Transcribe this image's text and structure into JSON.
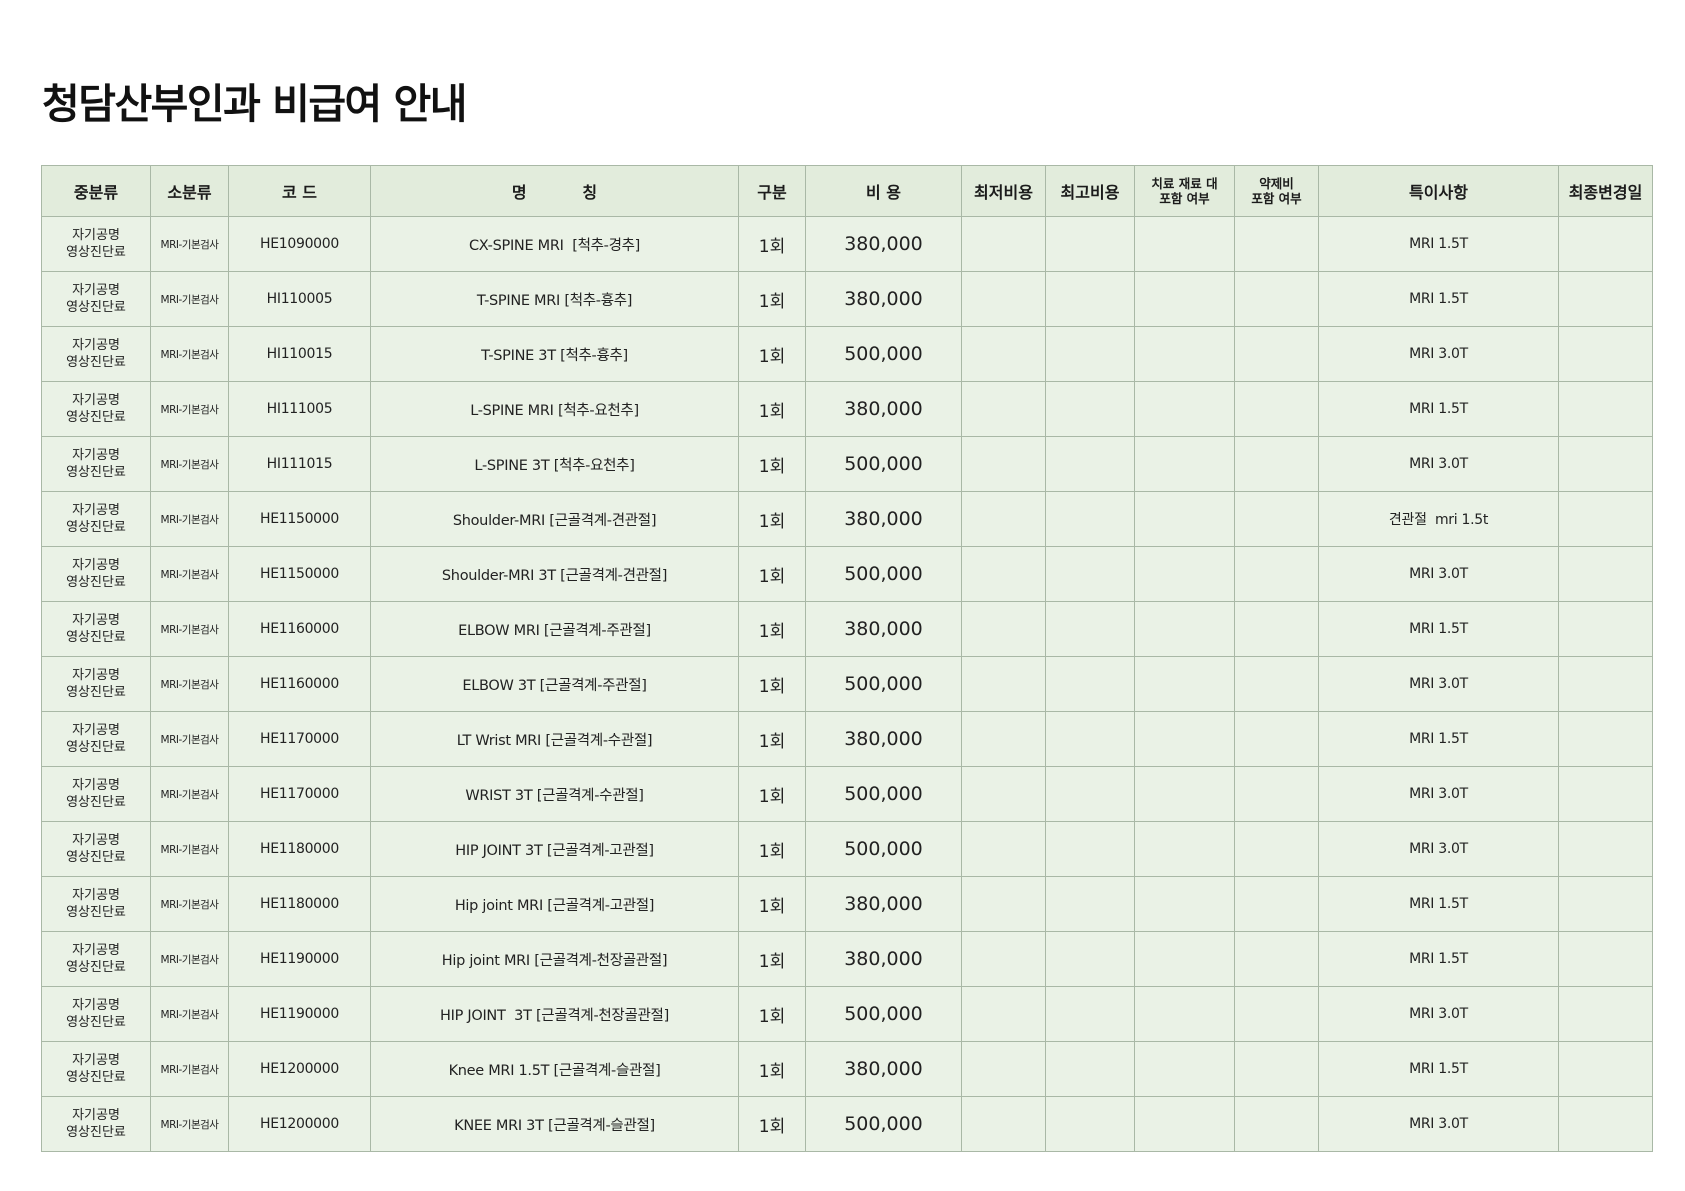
{
  "title": "청담산부인과 비급여 안내",
  "headers": {
    "mid": "중분류",
    "sub": "소분류",
    "code": "코 드",
    "name": "명          칭",
    "unit": "구분",
    "cost": "비 용",
    "min_cost": "최저비용",
    "max_cost": "최고비용",
    "material_line1": "치료 재료 대",
    "material_line2": "포함 여부",
    "drug_line1": "약제비",
    "drug_line2": "포함 여부",
    "note": "특이사항",
    "updated": "최종변경일"
  },
  "rows": [
    {
      "mid1": "자기공명",
      "mid2": "영상진단료",
      "sub": "MRI-기본검사",
      "code": "HE1090000",
      "name": "CX-SPINE MRI  [척추-경추]",
      "unit": "1회",
      "cost": "380,000",
      "min": "",
      "max": "",
      "material": "",
      "drug": "",
      "note": "MRI 1.5T",
      "updated": ""
    },
    {
      "mid1": "자기공명",
      "mid2": "영상진단료",
      "sub": "MRI-기본검사",
      "code": "HI110005",
      "name": "T-SPINE MRI [척추-흉추]",
      "unit": "1회",
      "cost": "380,000",
      "min": "",
      "max": "",
      "material": "",
      "drug": "",
      "note": "MRI 1.5T",
      "updated": ""
    },
    {
      "mid1": "자기공명",
      "mid2": "영상진단료",
      "sub": "MRI-기본검사",
      "code": "HI110015",
      "name": "T-SPINE 3T [척추-흉추]",
      "unit": "1회",
      "cost": "500,000",
      "min": "",
      "max": "",
      "material": "",
      "drug": "",
      "note": "MRI 3.0T",
      "updated": ""
    },
    {
      "mid1": "자기공명",
      "mid2": "영상진단료",
      "sub": "MRI-기본검사",
      "code": "HI111005",
      "name": "L-SPINE MRI [척추-요천추]",
      "unit": "1회",
      "cost": "380,000",
      "min": "",
      "max": "",
      "material": "",
      "drug": "",
      "note": "MRI 1.5T",
      "updated": ""
    },
    {
      "mid1": "자기공명",
      "mid2": "영상진단료",
      "sub": "MRI-기본검사",
      "code": "HI111015",
      "name": "L-SPINE 3T [척추-요천추]",
      "unit": "1회",
      "cost": "500,000",
      "min": "",
      "max": "",
      "material": "",
      "drug": "",
      "note": "MRI 3.0T",
      "updated": ""
    },
    {
      "mid1": "자기공명",
      "mid2": "영상진단료",
      "sub": "MRI-기본검사",
      "code": "HE1150000",
      "name": "Shoulder-MRI [근골격계-견관절]",
      "unit": "1회",
      "cost": "380,000",
      "min": "",
      "max": "",
      "material": "",
      "drug": "",
      "note": "견관절  mri 1.5t",
      "updated": ""
    },
    {
      "mid1": "자기공명",
      "mid2": "영상진단료",
      "sub": "MRI-기본검사",
      "code": "HE1150000",
      "name": "Shoulder-MRI 3T [근골격계-견관절]",
      "unit": "1회",
      "cost": "500,000",
      "min": "",
      "max": "",
      "material": "",
      "drug": "",
      "note": "MRI 3.0T",
      "updated": ""
    },
    {
      "mid1": "자기공명",
      "mid2": "영상진단료",
      "sub": "MRI-기본검사",
      "code": "HE1160000",
      "name": "ELBOW MRI [근골격계-주관절]",
      "unit": "1회",
      "cost": "380,000",
      "min": "",
      "max": "",
      "material": "",
      "drug": "",
      "note": "MRI 1.5T",
      "updated": ""
    },
    {
      "mid1": "자기공명",
      "mid2": "영상진단료",
      "sub": "MRI-기본검사",
      "code": "HE1160000",
      "name": "ELBOW 3T [근골격계-주관절]",
      "unit": "1회",
      "cost": "500,000",
      "min": "",
      "max": "",
      "material": "",
      "drug": "",
      "note": "MRI 3.0T",
      "updated": ""
    },
    {
      "mid1": "자기공명",
      "mid2": "영상진단료",
      "sub": "MRI-기본검사",
      "code": "HE1170000",
      "name": "LT Wrist MRI [근골격계-수관절]",
      "unit": "1회",
      "cost": "380,000",
      "min": "",
      "max": "",
      "material": "",
      "drug": "",
      "note": "MRI 1.5T",
      "updated": ""
    },
    {
      "mid1": "자기공명",
      "mid2": "영상진단료",
      "sub": "MRI-기본검사",
      "code": "HE1170000",
      "name": "WRIST 3T [근골격계-수관절]",
      "unit": "1회",
      "cost": "500,000",
      "min": "",
      "max": "",
      "material": "",
      "drug": "",
      "note": "MRI 3.0T",
      "updated": ""
    },
    {
      "mid1": "자기공명",
      "mid2": "영상진단료",
      "sub": "MRI-기본검사",
      "code": "HE1180000",
      "name": "HIP JOINT 3T [근골격계-고관절]",
      "unit": "1회",
      "cost": "500,000",
      "min": "",
      "max": "",
      "material": "",
      "drug": "",
      "note": "MRI 3.0T",
      "updated": ""
    },
    {
      "mid1": "자기공명",
      "mid2": "영상진단료",
      "sub": "MRI-기본검사",
      "code": "HE1180000",
      "name": "Hip joint MRI [근골격계-고관절]",
      "unit": "1회",
      "cost": "380,000",
      "min": "",
      "max": "",
      "material": "",
      "drug": "",
      "note": "MRI 1.5T",
      "updated": ""
    },
    {
      "mid1": "자기공명",
      "mid2": "영상진단료",
      "sub": "MRI-기본검사",
      "code": "HE1190000",
      "name": "Hip joint MRI [근골격계-천장골관절]",
      "unit": "1회",
      "cost": "380,000",
      "min": "",
      "max": "",
      "material": "",
      "drug": "",
      "note": "MRI 1.5T",
      "updated": ""
    },
    {
      "mid1": "자기공명",
      "mid2": "영상진단료",
      "sub": "MRI-기본검사",
      "code": "HE1190000",
      "name": "HIP JOINT  3T [근골격계-천장골관절]",
      "unit": "1회",
      "cost": "500,000",
      "min": "",
      "max": "",
      "material": "",
      "drug": "",
      "note": "MRI 3.0T",
      "updated": ""
    },
    {
      "mid1": "자기공명",
      "mid2": "영상진단료",
      "sub": "MRI-기본검사",
      "code": "HE1200000",
      "name": "Knee MRI 1.5T [근골격계-슬관절]",
      "unit": "1회",
      "cost": "380,000",
      "min": "",
      "max": "",
      "material": "",
      "drug": "",
      "note": "MRI 1.5T",
      "updated": ""
    },
    {
      "mid1": "자기공명",
      "mid2": "영상진단료",
      "sub": "MRI-기본검사",
      "code": "HE1200000",
      "name": "KNEE MRI 3T [근골격계-슬관절]",
      "unit": "1회",
      "cost": "500,000",
      "min": "",
      "max": "",
      "material": "",
      "drug": "",
      "note": "MRI 3.0T",
      "updated": ""
    }
  ]
}
